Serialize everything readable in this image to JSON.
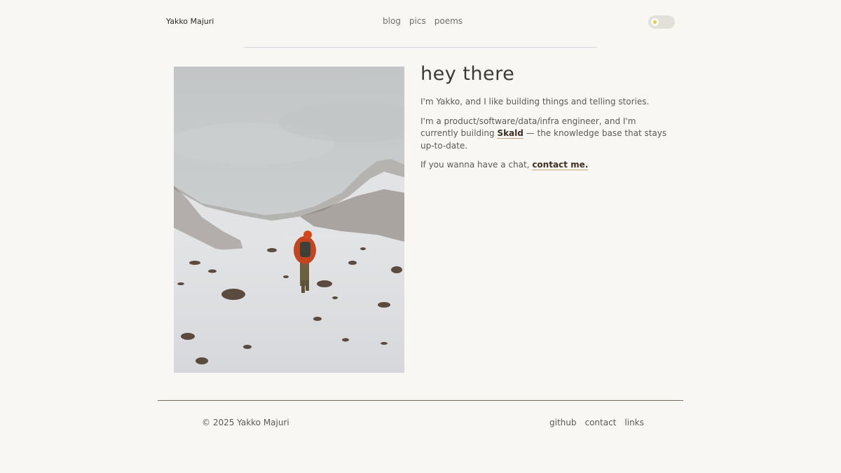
{
  "header": {
    "site_name": "Yakko Majuri",
    "nav": [
      "blog",
      "pics",
      "poems"
    ]
  },
  "intro": {
    "heading": "hey there",
    "p1": "I'm Yakko, and I like building things and telling stories.",
    "p2_before": "I'm a product/software/data/infra engineer, and I'm currently building ",
    "p2_link": "Skald",
    "p2_after": " — the knowledge base that stays up-to-date.",
    "p3_before": "If you wanna have a chat, ",
    "p3_link": "contact me."
  },
  "photo": {
    "alt": "hiker walking up a snowy mountain valley"
  },
  "footer": {
    "copyright": "© 2025 Yakko Majuri",
    "links": [
      "github",
      "contact",
      "links"
    ]
  },
  "colors": {
    "background": "#f8f7f3",
    "link_underline": "#c4a27a",
    "toggle_sun": "#e3c94e"
  }
}
